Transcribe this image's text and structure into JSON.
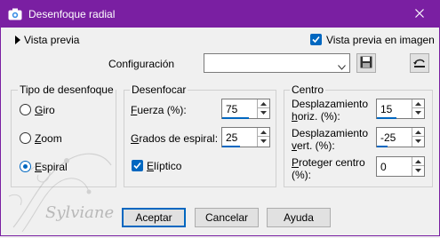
{
  "window": {
    "title": "Desenfoque radial"
  },
  "preview": {
    "toggle_label": "Vista previa",
    "checkbox_label": "Vista previa en imagen",
    "checked": true
  },
  "config": {
    "label": "Configuración",
    "value": ""
  },
  "blur_type": {
    "title": "Tipo de desenfoque",
    "options": [
      {
        "key": "G",
        "rest": "iro",
        "selected": false
      },
      {
        "key": "Z",
        "rest": "oom",
        "selected": false
      },
      {
        "key": "E",
        "rest": "spiral",
        "selected": true
      }
    ]
  },
  "blur": {
    "title": "Desenfocar",
    "strength": {
      "key": "F",
      "rest": "uerza (%):",
      "value": "75",
      "fill": 0.75
    },
    "spiral_degrees": {
      "key": "G",
      "rest": "rados de espiral:",
      "value": "25",
      "fill": 0.5
    },
    "elliptic": {
      "key": "E",
      "rest": "líptico",
      "checked": true
    }
  },
  "center": {
    "title": "Centro",
    "horiz": {
      "line1": "Desplazamiento",
      "key": "h",
      "rest": "oriz. (%):",
      "value": "15",
      "fill": 0.55
    },
    "vert": {
      "line1": "Desplazamiento",
      "key": "v",
      "rest": "ert. (%):",
      "value": "-25",
      "fill": 0.3
    },
    "protect": {
      "line1_key": "P",
      "line1_rest": "roteger centro",
      "line2": "(%):",
      "value": "0",
      "fill": 0.0
    }
  },
  "buttons": {
    "ok": "Aceptar",
    "cancel": "Cancelar",
    "help": "Ayuda"
  },
  "watermark": {
    "text": "Sylviane"
  },
  "colors": {
    "accent": "#7a1fa2",
    "focus": "#0067c0"
  }
}
